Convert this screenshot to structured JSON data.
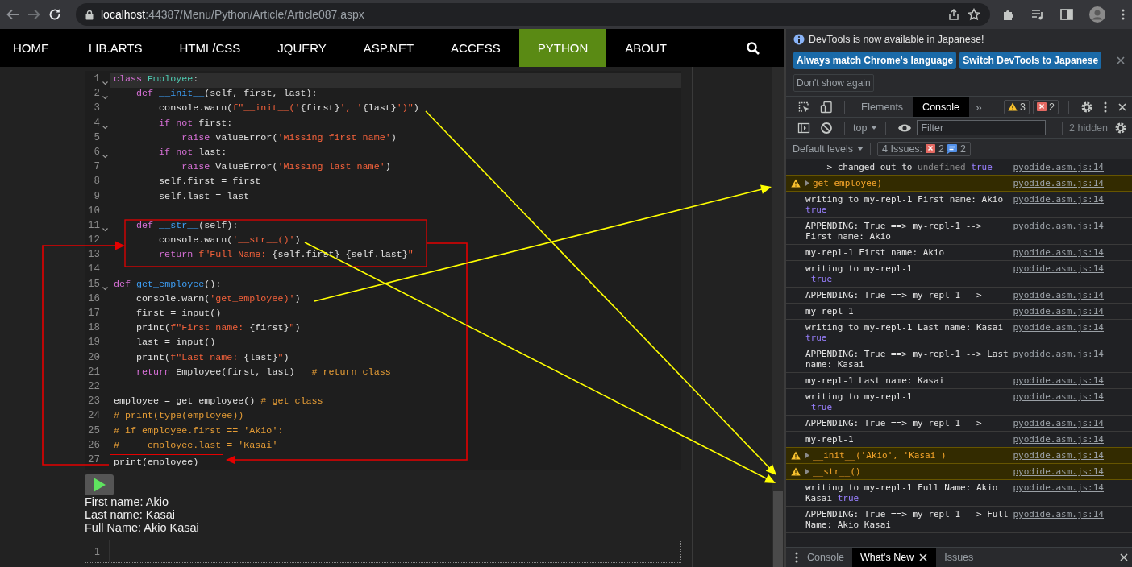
{
  "browser": {
    "url": "**localhost**:44387/Menu/Python/Article/Article087.aspx"
  },
  "nav": {
    "items": [
      {
        "label": "HOME",
        "selected": false
      },
      {
        "label": "LIB.ARTS",
        "selected": false
      },
      {
        "label": "HTML/CSS",
        "selected": false
      },
      {
        "label": "JQUERY",
        "selected": false
      },
      {
        "label": "ASP.NET",
        "selected": false
      },
      {
        "label": "ACCESS",
        "selected": false
      },
      {
        "label": "PYTHON",
        "selected": true
      },
      {
        "label": "ABOUT",
        "selected": false
      }
    ]
  },
  "editor": {
    "lines": [
      {
        "number": "1",
        "fold": true,
        "active": true,
        "framed": false,
        "tokens": [
          {
            "kw": "class"
          },
          {
            "cls": " Employee"
          },
          {
            "plain": ":"
          }
        ]
      },
      {
        "number": "2",
        "fold": true,
        "active": false,
        "framed": false,
        "tokens": [
          {
            "kw": "    def"
          },
          {
            "name": " __init__"
          },
          {
            "plain": "(self, first, last):"
          }
        ]
      },
      {
        "number": "3",
        "fold": false,
        "active": false,
        "framed": false,
        "tokens": [
          {
            "plain": "        console.warn("
          },
          {
            "str": "f\"__init__('"
          },
          {
            "plain": "{first}"
          },
          {
            "str": "', '"
          },
          {
            "plain": "{last}"
          },
          {
            "str": "')\""
          },
          {
            "plain": ")"
          }
        ]
      },
      {
        "number": "4",
        "fold": true,
        "active": false,
        "framed": false,
        "tokens": [
          {
            "kw": "        if not"
          },
          {
            "plain": " first:"
          }
        ]
      },
      {
        "number": "5",
        "fold": false,
        "active": false,
        "framed": false,
        "tokens": [
          {
            "kw": "            raise"
          },
          {
            "plain": " ValueError("
          },
          {
            "str": "'Missing first name'"
          },
          {
            "plain": ")"
          }
        ]
      },
      {
        "number": "6",
        "fold": true,
        "active": false,
        "framed": false,
        "tokens": [
          {
            "kw": "        if not"
          },
          {
            "plain": " last:"
          }
        ]
      },
      {
        "number": "7",
        "fold": false,
        "active": false,
        "framed": false,
        "tokens": [
          {
            "kw": "            raise"
          },
          {
            "plain": " ValueError("
          },
          {
            "str": "'Missing last name'"
          },
          {
            "plain": ")"
          }
        ]
      },
      {
        "number": "8",
        "fold": false,
        "active": false,
        "framed": false,
        "tokens": [
          {
            "plain": "        self.first = first"
          }
        ]
      },
      {
        "number": "9",
        "fold": false,
        "active": false,
        "framed": false,
        "tokens": [
          {
            "plain": "        self.last = last"
          }
        ]
      },
      {
        "number": "10",
        "fold": false,
        "active": false,
        "framed": false
      },
      {
        "number": "11",
        "fold": true,
        "active": false,
        "framed": false,
        "tokens": [
          {
            "kw": "    def"
          },
          {
            "name": " __str__"
          },
          {
            "plain": "(self):"
          }
        ]
      },
      {
        "number": "12",
        "fold": false,
        "active": false,
        "framed": false,
        "tokens": [
          {
            "plain": "        console.warn("
          },
          {
            "str": "'__str__()'"
          },
          {
            "plain": ")"
          }
        ]
      },
      {
        "number": "13",
        "fold": false,
        "active": false,
        "framed": false,
        "tokens": [
          {
            "kw": "        return"
          },
          {
            "str": " f\"Full Name: "
          },
          {
            "plain": "{self.first} {self.last}"
          },
          {
            "str": "\""
          }
        ]
      },
      {
        "number": "14",
        "fold": false,
        "active": false,
        "framed": false
      },
      {
        "number": "15",
        "fold": true,
        "active": false,
        "framed": false,
        "tokens": [
          {
            "kw": "def"
          },
          {
            "name": " get_employee"
          },
          {
            "plain": "():"
          }
        ]
      },
      {
        "number": "16",
        "fold": false,
        "active": false,
        "framed": false,
        "tokens": [
          {
            "plain": "    console.warn("
          },
          {
            "str": "'get_employee)'"
          },
          {
            "plain": ")"
          }
        ]
      },
      {
        "number": "17",
        "fold": false,
        "active": false,
        "framed": false,
        "tokens": [
          {
            "plain": "    first = input()"
          }
        ]
      },
      {
        "number": "18",
        "fold": false,
        "active": false,
        "framed": false,
        "tokens": [
          {
            "plain": "    print("
          },
          {
            "str": "f\"First name: "
          },
          {
            "plain": "{first}"
          },
          {
            "str": "\""
          },
          {
            "plain": ")"
          }
        ]
      },
      {
        "number": "19",
        "fold": false,
        "active": false,
        "framed": false,
        "tokens": [
          {
            "plain": "    last = input()"
          }
        ]
      },
      {
        "number": "20",
        "fold": false,
        "active": false,
        "framed": false,
        "tokens": [
          {
            "plain": "    print("
          },
          {
            "str": "f\"Last name: "
          },
          {
            "plain": "{last}"
          },
          {
            "str": "\""
          },
          {
            "plain": ")"
          }
        ]
      },
      {
        "number": "21",
        "fold": false,
        "active": false,
        "framed": false,
        "tokens": [
          {
            "kw": "    return"
          },
          {
            "plain": " Employee(first, last)   "
          },
          {
            "cm": "# return class"
          }
        ]
      },
      {
        "number": "22",
        "fold": false,
        "active": false,
        "framed": false
      },
      {
        "number": "23",
        "fold": false,
        "active": false,
        "framed": false,
        "tokens": [
          {
            "plain": "employee = get_employee() "
          },
          {
            "cm": "# get class"
          }
        ]
      },
      {
        "number": "24",
        "fold": false,
        "active": false,
        "framed": false,
        "tokens": [
          {
            "cm": "# print(type(employee))"
          }
        ]
      },
      {
        "number": "25",
        "fold": false,
        "active": false,
        "framed": false,
        "tokens": [
          {
            "cm": "# if employee.first == 'Akio':"
          }
        ]
      },
      {
        "number": "26",
        "fold": false,
        "active": false,
        "framed": false,
        "tokens": [
          {
            "cm": "#     employee.last = 'Kasai'"
          }
        ]
      },
      {
        "number": "27",
        "fold": false,
        "active": false,
        "framed": true,
        "tokens": [
          {
            "plain": "print(employee)"
          }
        ]
      }
    ]
  },
  "output": [
    "First name: Akio",
    "Last name: Kasai",
    "Full Name: Akio Kasai"
  ],
  "editor_2": {
    "lines": [
      {
        "number": "1"
      }
    ]
  },
  "devtools": {
    "infobar": {
      "message": "DevTools is now available in Japanese!",
      "buttons": [
        "Always match Chrome's language",
        "Switch DevTools to Japanese"
      ],
      "dismiss": "Don't show again"
    },
    "tabs": [
      {
        "label": "Elements",
        "selected": false
      },
      {
        "label": "Console",
        "selected": true
      }
    ],
    "more_tabs": "»",
    "warnings": "3",
    "errors": "2",
    "console_toolbar": {
      "context": "top",
      "filter_placeholder": "Filter",
      "hidden": "2 hidden"
    },
    "levels": {
      "label": "Default levels",
      "issues_label": "4 Issues:",
      "issue_errors": "2",
      "issue_info": "2"
    },
    "messages": [
      {
        "kind": "log",
        "segments": [
          {
            "plain": "----> changed out to "
          },
          {
            "undef": "undefined"
          },
          {
            "bool": " true"
          }
        ],
        "source": "pyodide.asm.js:14"
      },
      {
        "kind": "warn",
        "segments": [
          {
            "plain": "get_employee)"
          }
        ],
        "source": "pyodide.asm.js:14"
      },
      {
        "kind": "log",
        "segments": [
          {
            "plain": "writing to my-repl-1 First name: Akio"
          },
          {
            "bool": " true"
          }
        ],
        "source": "pyodide.asm.js:14"
      },
      {
        "kind": "log",
        "segments": [
          {
            "plain": "APPENDING: True ==> my-repl-1 --> First name: Akio"
          }
        ],
        "source": "pyodide.asm.js:14"
      },
      {
        "kind": "log",
        "segments": [
          {
            "plain": "my-repl-1 First name: Akio"
          }
        ],
        "source": "pyodide.asm.js:14"
      },
      {
        "kind": "log",
        "segments": [
          {
            "plain": "writing to my-repl-1"
          },
          {
            "bool": "\n true"
          }
        ],
        "source": "pyodide.asm.js:14"
      },
      {
        "kind": "log",
        "segments": [
          {
            "plain": "APPENDING: True ==> my-repl-1 -->"
          }
        ],
        "source": "pyodide.asm.js:14"
      },
      {
        "kind": "log",
        "segments": [
          {
            "plain": "my-repl-1"
          }
        ],
        "source": "pyodide.asm.js:14"
      },
      {
        "kind": "log",
        "segments": [
          {
            "plain": "writing to my-repl-1 Last name: Kasai"
          },
          {
            "bool": " true"
          }
        ],
        "source": "pyodide.asm.js:14"
      },
      {
        "kind": "log",
        "segments": [
          {
            "plain": "APPENDING: True ==> my-repl-1 --> Last name: Kasai"
          }
        ],
        "source": "pyodide.asm.js:14"
      },
      {
        "kind": "log",
        "segments": [
          {
            "plain": "my-repl-1 Last name: Kasai"
          }
        ],
        "source": "pyodide.asm.js:14"
      },
      {
        "kind": "log",
        "segments": [
          {
            "plain": "writing to my-repl-1"
          },
          {
            "bool": "\n true"
          }
        ],
        "source": "pyodide.asm.js:14"
      },
      {
        "kind": "log",
        "segments": [
          {
            "plain": "APPENDING: True ==> my-repl-1 -->"
          }
        ],
        "source": "pyodide.asm.js:14"
      },
      {
        "kind": "log",
        "segments": [
          {
            "plain": "my-repl-1"
          }
        ],
        "source": "pyodide.asm.js:14"
      },
      {
        "kind": "warn",
        "segments": [
          {
            "plain": "__init__('Akio', 'Kasai')"
          }
        ],
        "source": "pyodide.asm.js:14"
      },
      {
        "kind": "warn",
        "segments": [
          {
            "plain": "__str__()"
          }
        ],
        "source": "pyodide.asm.js:14"
      },
      {
        "kind": "log",
        "segments": [
          {
            "plain": "writing to my-repl-1 Full Name: Akio Kasai"
          },
          {
            "bool": " true"
          }
        ],
        "source": "pyodide.asm.js:14"
      },
      {
        "kind": "log",
        "segments": [
          {
            "plain": "APPENDING: True ==> my-repl-1 --> Full Name: Akio Kasai"
          }
        ],
        "source": "pyodide.asm.js:14"
      }
    ],
    "drawer_tabs": [
      {
        "label": "Console",
        "selected": false,
        "closable": false
      },
      {
        "label": "What's New",
        "selected": true,
        "closable": true
      },
      {
        "label": "Issues",
        "selected": false,
        "closable": false
      }
    ]
  }
}
